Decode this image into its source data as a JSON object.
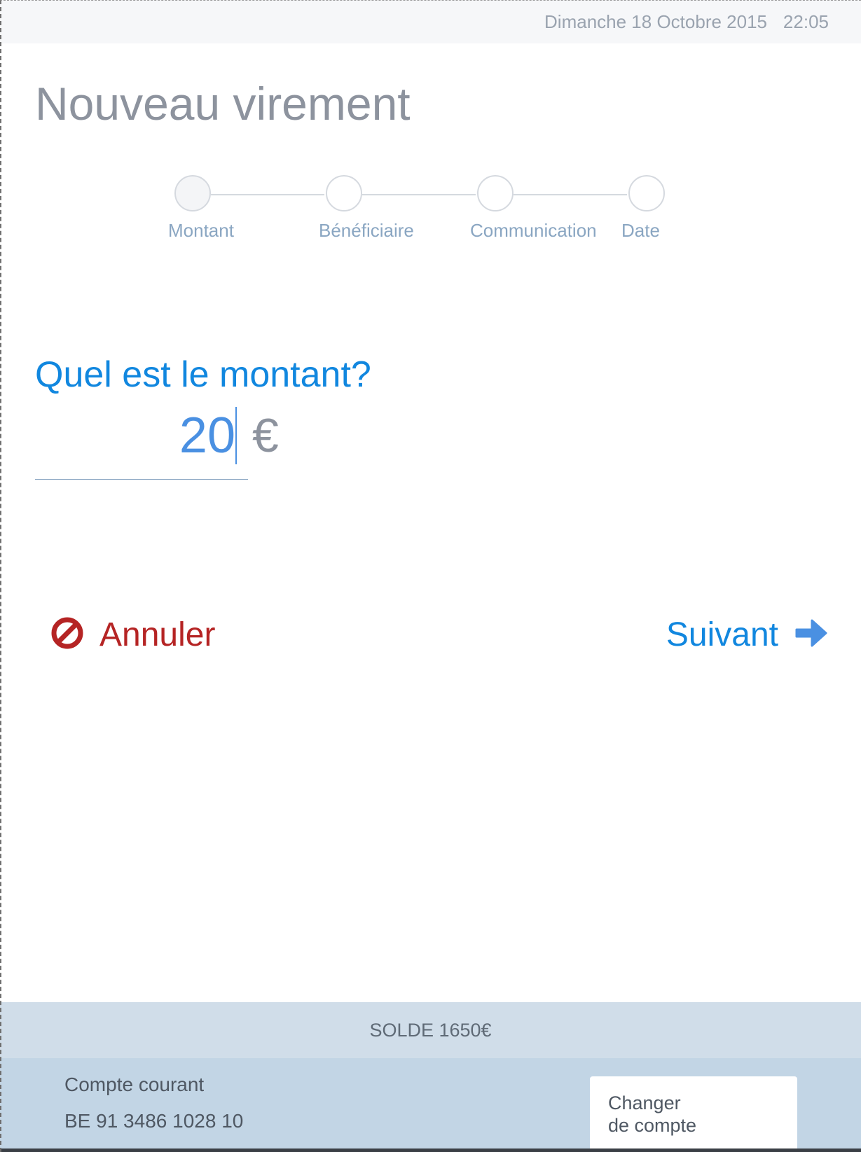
{
  "header": {
    "date": "Dimanche 18 Octobre 2015",
    "time": "22:05"
  },
  "page": {
    "title": "Nouveau virement"
  },
  "stepper": {
    "current_step": 1,
    "steps": [
      {
        "label": "Montant"
      },
      {
        "label": "Bénéficiaire"
      },
      {
        "label": "Communication"
      },
      {
        "label": "Date"
      }
    ]
  },
  "amount_form": {
    "question": "Quel est le montant?",
    "value": "20",
    "currency": "€"
  },
  "actions": {
    "cancel_label": "Annuler",
    "cancel_icon": "forbidden-icon",
    "next_label": "Suivant",
    "next_icon": "arrow-right-icon"
  },
  "footer": {
    "balance": "SOLDE 1650€",
    "account_type": "Compte courant",
    "account_number": "BE 91 3486 1028 10",
    "change_account_line1": "Changer",
    "change_account_line2": "de compte"
  },
  "colors": {
    "accent": "#1187df",
    "cancel": "#b52424",
    "balance_bar": "#d0dde9",
    "account_bar": "#c2d5e5"
  }
}
